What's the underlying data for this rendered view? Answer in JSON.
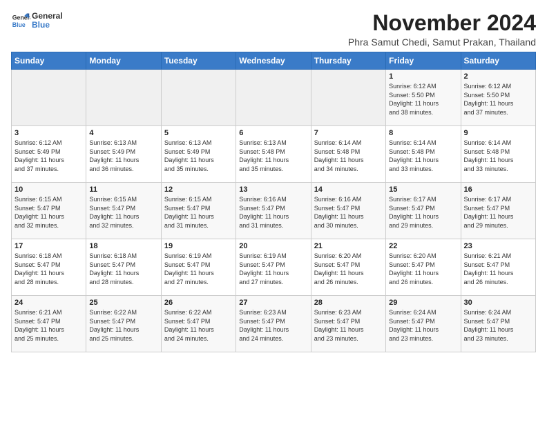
{
  "header": {
    "logo_line1": "General",
    "logo_line2": "Blue",
    "month": "November 2024",
    "location": "Phra Samut Chedi, Samut Prakan, Thailand"
  },
  "weekdays": [
    "Sunday",
    "Monday",
    "Tuesday",
    "Wednesday",
    "Thursday",
    "Friday",
    "Saturday"
  ],
  "weeks": [
    [
      {
        "day": "",
        "content": ""
      },
      {
        "day": "",
        "content": ""
      },
      {
        "day": "",
        "content": ""
      },
      {
        "day": "",
        "content": ""
      },
      {
        "day": "",
        "content": ""
      },
      {
        "day": "1",
        "content": "Sunrise: 6:12 AM\nSunset: 5:50 PM\nDaylight: 11 hours\nand 38 minutes."
      },
      {
        "day": "2",
        "content": "Sunrise: 6:12 AM\nSunset: 5:50 PM\nDaylight: 11 hours\nand 37 minutes."
      }
    ],
    [
      {
        "day": "3",
        "content": "Sunrise: 6:12 AM\nSunset: 5:49 PM\nDaylight: 11 hours\nand 37 minutes."
      },
      {
        "day": "4",
        "content": "Sunrise: 6:13 AM\nSunset: 5:49 PM\nDaylight: 11 hours\nand 36 minutes."
      },
      {
        "day": "5",
        "content": "Sunrise: 6:13 AM\nSunset: 5:49 PM\nDaylight: 11 hours\nand 35 minutes."
      },
      {
        "day": "6",
        "content": "Sunrise: 6:13 AM\nSunset: 5:48 PM\nDaylight: 11 hours\nand 35 minutes."
      },
      {
        "day": "7",
        "content": "Sunrise: 6:14 AM\nSunset: 5:48 PM\nDaylight: 11 hours\nand 34 minutes."
      },
      {
        "day": "8",
        "content": "Sunrise: 6:14 AM\nSunset: 5:48 PM\nDaylight: 11 hours\nand 33 minutes."
      },
      {
        "day": "9",
        "content": "Sunrise: 6:14 AM\nSunset: 5:48 PM\nDaylight: 11 hours\nand 33 minutes."
      }
    ],
    [
      {
        "day": "10",
        "content": "Sunrise: 6:15 AM\nSunset: 5:47 PM\nDaylight: 11 hours\nand 32 minutes."
      },
      {
        "day": "11",
        "content": "Sunrise: 6:15 AM\nSunset: 5:47 PM\nDaylight: 11 hours\nand 32 minutes."
      },
      {
        "day": "12",
        "content": "Sunrise: 6:15 AM\nSunset: 5:47 PM\nDaylight: 11 hours\nand 31 minutes."
      },
      {
        "day": "13",
        "content": "Sunrise: 6:16 AM\nSunset: 5:47 PM\nDaylight: 11 hours\nand 31 minutes."
      },
      {
        "day": "14",
        "content": "Sunrise: 6:16 AM\nSunset: 5:47 PM\nDaylight: 11 hours\nand 30 minutes."
      },
      {
        "day": "15",
        "content": "Sunrise: 6:17 AM\nSunset: 5:47 PM\nDaylight: 11 hours\nand 29 minutes."
      },
      {
        "day": "16",
        "content": "Sunrise: 6:17 AM\nSunset: 5:47 PM\nDaylight: 11 hours\nand 29 minutes."
      }
    ],
    [
      {
        "day": "17",
        "content": "Sunrise: 6:18 AM\nSunset: 5:47 PM\nDaylight: 11 hours\nand 28 minutes."
      },
      {
        "day": "18",
        "content": "Sunrise: 6:18 AM\nSunset: 5:47 PM\nDaylight: 11 hours\nand 28 minutes."
      },
      {
        "day": "19",
        "content": "Sunrise: 6:19 AM\nSunset: 5:47 PM\nDaylight: 11 hours\nand 27 minutes."
      },
      {
        "day": "20",
        "content": "Sunrise: 6:19 AM\nSunset: 5:47 PM\nDaylight: 11 hours\nand 27 minutes."
      },
      {
        "day": "21",
        "content": "Sunrise: 6:20 AM\nSunset: 5:47 PM\nDaylight: 11 hours\nand 26 minutes."
      },
      {
        "day": "22",
        "content": "Sunrise: 6:20 AM\nSunset: 5:47 PM\nDaylight: 11 hours\nand 26 minutes."
      },
      {
        "day": "23",
        "content": "Sunrise: 6:21 AM\nSunset: 5:47 PM\nDaylight: 11 hours\nand 26 minutes."
      }
    ],
    [
      {
        "day": "24",
        "content": "Sunrise: 6:21 AM\nSunset: 5:47 PM\nDaylight: 11 hours\nand 25 minutes."
      },
      {
        "day": "25",
        "content": "Sunrise: 6:22 AM\nSunset: 5:47 PM\nDaylight: 11 hours\nand 25 minutes."
      },
      {
        "day": "26",
        "content": "Sunrise: 6:22 AM\nSunset: 5:47 PM\nDaylight: 11 hours\nand 24 minutes."
      },
      {
        "day": "27",
        "content": "Sunrise: 6:23 AM\nSunset: 5:47 PM\nDaylight: 11 hours\nand 24 minutes."
      },
      {
        "day": "28",
        "content": "Sunrise: 6:23 AM\nSunset: 5:47 PM\nDaylight: 11 hours\nand 23 minutes."
      },
      {
        "day": "29",
        "content": "Sunrise: 6:24 AM\nSunset: 5:47 PM\nDaylight: 11 hours\nand 23 minutes."
      },
      {
        "day": "30",
        "content": "Sunrise: 6:24 AM\nSunset: 5:47 PM\nDaylight: 11 hours\nand 23 minutes."
      }
    ]
  ]
}
